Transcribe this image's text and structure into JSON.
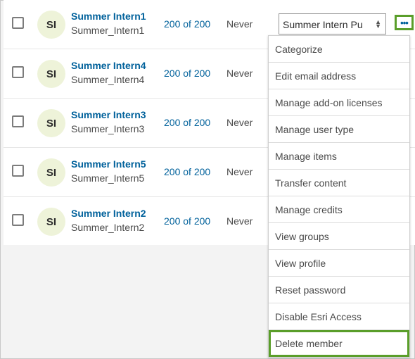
{
  "members": [
    {
      "initials": "SI",
      "full_name": "Summer Intern1",
      "username": "Summer_Intern1",
      "credits": "200 of 200",
      "last_login": "Never",
      "user_type": "Summer Intern Pu"
    },
    {
      "initials": "SI",
      "full_name": "Summer Intern4",
      "username": "Summer_Intern4",
      "credits": "200 of 200",
      "last_login": "Never"
    },
    {
      "initials": "SI",
      "full_name": "Summer Intern3",
      "username": "Summer_Intern3",
      "credits": "200 of 200",
      "last_login": "Never"
    },
    {
      "initials": "SI",
      "full_name": "Summer Intern5",
      "username": "Summer_Intern5",
      "credits": "200 of 200",
      "last_login": "Never"
    },
    {
      "initials": "SI",
      "full_name": "Summer Intern2",
      "username": "Summer_Intern2",
      "credits": "200 of 200",
      "last_login": "Never"
    }
  ],
  "more_button": {
    "glyph": "•••",
    "icon": "ellipsis-icon"
  },
  "select_arrows": {
    "up": "▲",
    "down": "▼"
  },
  "menu": {
    "items": [
      "Categorize",
      "Edit email address",
      "Manage add-on licenses",
      "Manage user type",
      "Manage items",
      "Transfer content",
      "Manage credits",
      "View groups",
      "View profile",
      "Reset password",
      "Disable Esri Access",
      "Delete member"
    ],
    "highlighted": "Delete member"
  },
  "colors": {
    "link": "#00619b",
    "highlight": "#5a9e2a",
    "avatar_bg": "#eef3d9"
  }
}
